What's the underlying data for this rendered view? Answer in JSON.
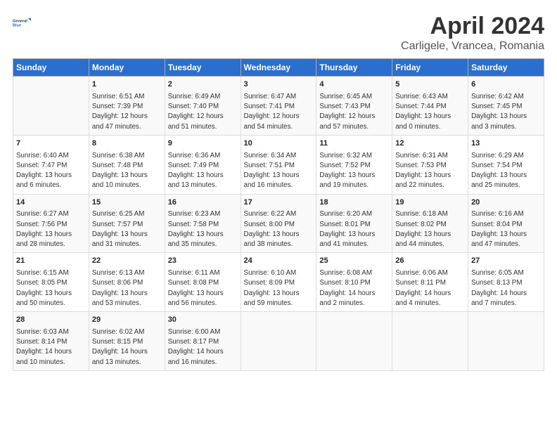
{
  "header": {
    "logo_line1": "General",
    "logo_line2": "Blue",
    "title": "April 2024",
    "subtitle": "Carligele, Vrancea, Romania"
  },
  "columns": [
    "Sunday",
    "Monday",
    "Tuesday",
    "Wednesday",
    "Thursday",
    "Friday",
    "Saturday"
  ],
  "weeks": [
    [
      {
        "day": "",
        "text": ""
      },
      {
        "day": "1",
        "text": "Sunrise: 6:51 AM\nSunset: 7:39 PM\nDaylight: 12 hours\nand 47 minutes."
      },
      {
        "day": "2",
        "text": "Sunrise: 6:49 AM\nSunset: 7:40 PM\nDaylight: 12 hours\nand 51 minutes."
      },
      {
        "day": "3",
        "text": "Sunrise: 6:47 AM\nSunset: 7:41 PM\nDaylight: 12 hours\nand 54 minutes."
      },
      {
        "day": "4",
        "text": "Sunrise: 6:45 AM\nSunset: 7:43 PM\nDaylight: 12 hours\nand 57 minutes."
      },
      {
        "day": "5",
        "text": "Sunrise: 6:43 AM\nSunset: 7:44 PM\nDaylight: 13 hours\nand 0 minutes."
      },
      {
        "day": "6",
        "text": "Sunrise: 6:42 AM\nSunset: 7:45 PM\nDaylight: 13 hours\nand 3 minutes."
      }
    ],
    [
      {
        "day": "7",
        "text": "Sunrise: 6:40 AM\nSunset: 7:47 PM\nDaylight: 13 hours\nand 6 minutes."
      },
      {
        "day": "8",
        "text": "Sunrise: 6:38 AM\nSunset: 7:48 PM\nDaylight: 13 hours\nand 10 minutes."
      },
      {
        "day": "9",
        "text": "Sunrise: 6:36 AM\nSunset: 7:49 PM\nDaylight: 13 hours\nand 13 minutes."
      },
      {
        "day": "10",
        "text": "Sunrise: 6:34 AM\nSunset: 7:51 PM\nDaylight: 13 hours\nand 16 minutes."
      },
      {
        "day": "11",
        "text": "Sunrise: 6:32 AM\nSunset: 7:52 PM\nDaylight: 13 hours\nand 19 minutes."
      },
      {
        "day": "12",
        "text": "Sunrise: 6:31 AM\nSunset: 7:53 PM\nDaylight: 13 hours\nand 22 minutes."
      },
      {
        "day": "13",
        "text": "Sunrise: 6:29 AM\nSunset: 7:54 PM\nDaylight: 13 hours\nand 25 minutes."
      }
    ],
    [
      {
        "day": "14",
        "text": "Sunrise: 6:27 AM\nSunset: 7:56 PM\nDaylight: 13 hours\nand 28 minutes."
      },
      {
        "day": "15",
        "text": "Sunrise: 6:25 AM\nSunset: 7:57 PM\nDaylight: 13 hours\nand 31 minutes."
      },
      {
        "day": "16",
        "text": "Sunrise: 6:23 AM\nSunset: 7:58 PM\nDaylight: 13 hours\nand 35 minutes."
      },
      {
        "day": "17",
        "text": "Sunrise: 6:22 AM\nSunset: 8:00 PM\nDaylight: 13 hours\nand 38 minutes."
      },
      {
        "day": "18",
        "text": "Sunrise: 6:20 AM\nSunset: 8:01 PM\nDaylight: 13 hours\nand 41 minutes."
      },
      {
        "day": "19",
        "text": "Sunrise: 6:18 AM\nSunset: 8:02 PM\nDaylight: 13 hours\nand 44 minutes."
      },
      {
        "day": "20",
        "text": "Sunrise: 6:16 AM\nSunset: 8:04 PM\nDaylight: 13 hours\nand 47 minutes."
      }
    ],
    [
      {
        "day": "21",
        "text": "Sunrise: 6:15 AM\nSunset: 8:05 PM\nDaylight: 13 hours\nand 50 minutes."
      },
      {
        "day": "22",
        "text": "Sunrise: 6:13 AM\nSunset: 8:06 PM\nDaylight: 13 hours\nand 53 minutes."
      },
      {
        "day": "23",
        "text": "Sunrise: 6:11 AM\nSunset: 8:08 PM\nDaylight: 13 hours\nand 56 minutes."
      },
      {
        "day": "24",
        "text": "Sunrise: 6:10 AM\nSunset: 8:09 PM\nDaylight: 13 hours\nand 59 minutes."
      },
      {
        "day": "25",
        "text": "Sunrise: 6:08 AM\nSunset: 8:10 PM\nDaylight: 14 hours\nand 2 minutes."
      },
      {
        "day": "26",
        "text": "Sunrise: 6:06 AM\nSunset: 8:11 PM\nDaylight: 14 hours\nand 4 minutes."
      },
      {
        "day": "27",
        "text": "Sunrise: 6:05 AM\nSunset: 8:13 PM\nDaylight: 14 hours\nand 7 minutes."
      }
    ],
    [
      {
        "day": "28",
        "text": "Sunrise: 6:03 AM\nSunset: 8:14 PM\nDaylight: 14 hours\nand 10 minutes."
      },
      {
        "day": "29",
        "text": "Sunrise: 6:02 AM\nSunset: 8:15 PM\nDaylight: 14 hours\nand 13 minutes."
      },
      {
        "day": "30",
        "text": "Sunrise: 6:00 AM\nSunset: 8:17 PM\nDaylight: 14 hours\nand 16 minutes."
      },
      {
        "day": "",
        "text": ""
      },
      {
        "day": "",
        "text": ""
      },
      {
        "day": "",
        "text": ""
      },
      {
        "day": "",
        "text": ""
      }
    ]
  ]
}
